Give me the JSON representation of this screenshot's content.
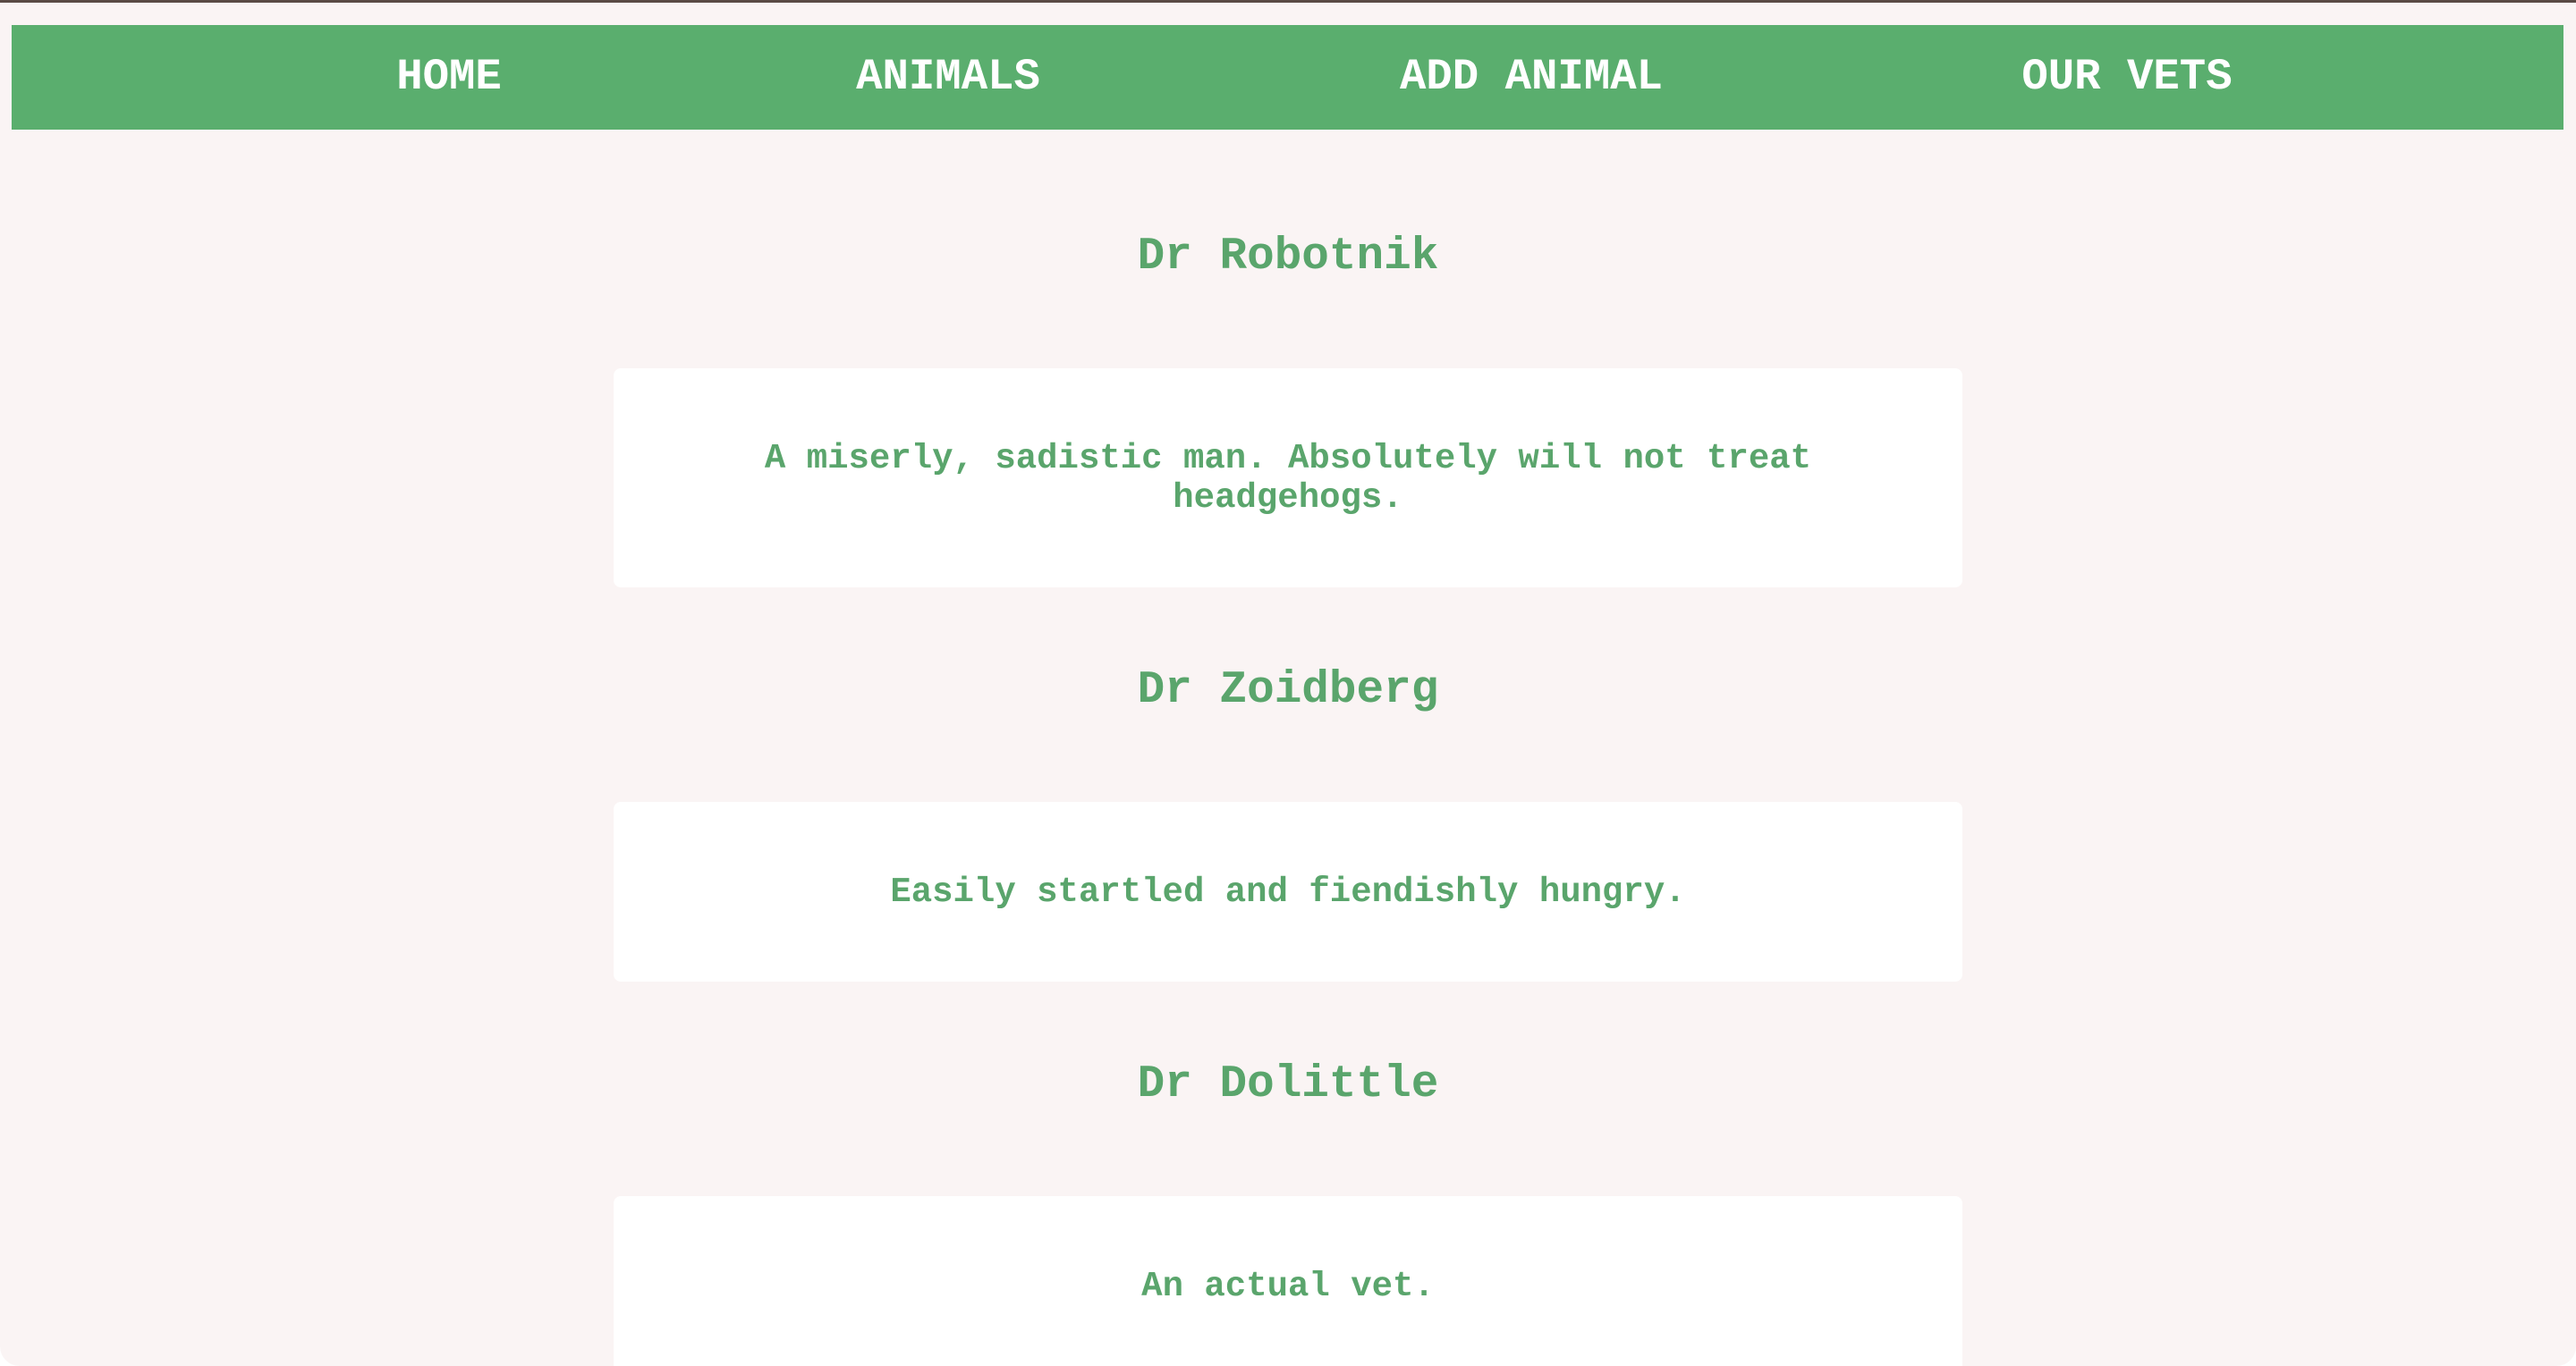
{
  "nav": {
    "items": [
      {
        "label": "HOME"
      },
      {
        "label": "ANIMALS"
      },
      {
        "label": "ADD ANIMAL"
      },
      {
        "label": "OUR VETS"
      }
    ]
  },
  "vets": [
    {
      "name": "Dr Robotnik",
      "description": "A miserly, sadistic man. Absolutely will not treat headgehogs."
    },
    {
      "name": "Dr Zoidberg",
      "description": "Easily startled and fiendishly hungry."
    },
    {
      "name": "Dr Dolittle",
      "description": "An actual vet."
    }
  ],
  "colors": {
    "accent": "#5aae6e",
    "text_green": "#5aa56c",
    "page_background": "#faf4f4",
    "card_background": "#ffffff"
  }
}
